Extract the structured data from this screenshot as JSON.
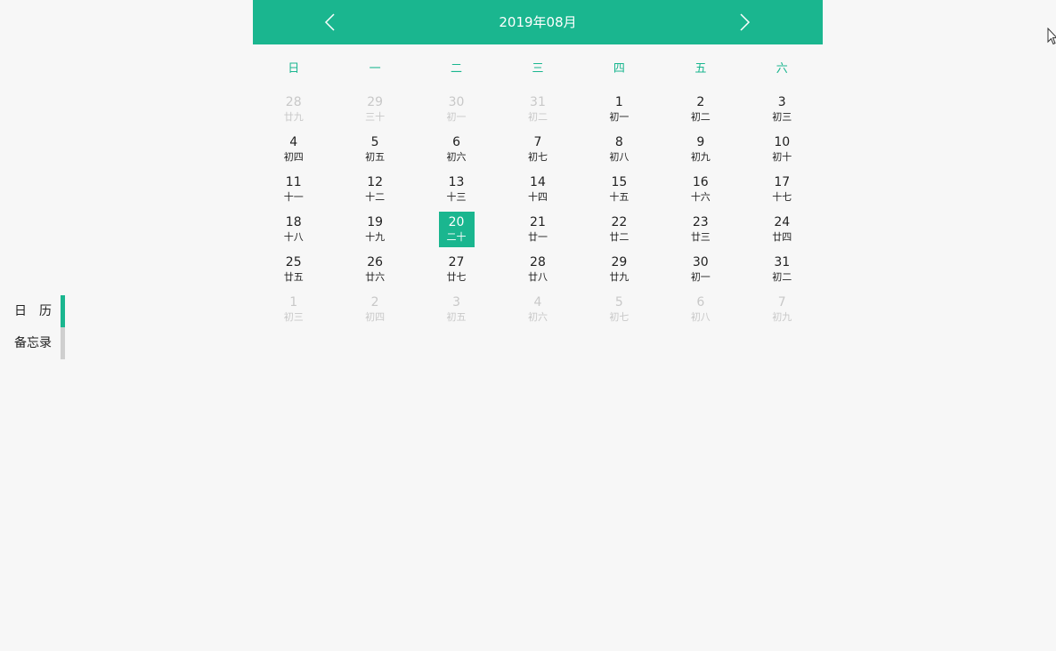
{
  "calendar": {
    "title": "2019年08月",
    "prev_icon": "chevron-left-icon",
    "next_icon": "chevron-right-icon",
    "weekdays": [
      "日",
      "一",
      "二",
      "三",
      "四",
      "五",
      "六"
    ],
    "days": [
      {
        "solar": "28",
        "lunar": "廿九",
        "other": true
      },
      {
        "solar": "29",
        "lunar": "三十",
        "other": true
      },
      {
        "solar": "30",
        "lunar": "初一",
        "other": true
      },
      {
        "solar": "31",
        "lunar": "初二",
        "other": true
      },
      {
        "solar": "1",
        "lunar": "初一"
      },
      {
        "solar": "2",
        "lunar": "初二"
      },
      {
        "solar": "3",
        "lunar": "初三"
      },
      {
        "solar": "4",
        "lunar": "初四"
      },
      {
        "solar": "5",
        "lunar": "初五"
      },
      {
        "solar": "6",
        "lunar": "初六"
      },
      {
        "solar": "7",
        "lunar": "初七"
      },
      {
        "solar": "8",
        "lunar": "初八"
      },
      {
        "solar": "9",
        "lunar": "初九"
      },
      {
        "solar": "10",
        "lunar": "初十"
      },
      {
        "solar": "11",
        "lunar": "十一"
      },
      {
        "solar": "12",
        "lunar": "十二"
      },
      {
        "solar": "13",
        "lunar": "十三"
      },
      {
        "solar": "14",
        "lunar": "十四"
      },
      {
        "solar": "15",
        "lunar": "十五"
      },
      {
        "solar": "16",
        "lunar": "十六"
      },
      {
        "solar": "17",
        "lunar": "十七"
      },
      {
        "solar": "18",
        "lunar": "十八"
      },
      {
        "solar": "19",
        "lunar": "十九"
      },
      {
        "solar": "20",
        "lunar": "二十",
        "selected": true
      },
      {
        "solar": "21",
        "lunar": "廿一"
      },
      {
        "solar": "22",
        "lunar": "廿二"
      },
      {
        "solar": "23",
        "lunar": "廿三"
      },
      {
        "solar": "24",
        "lunar": "廿四"
      },
      {
        "solar": "25",
        "lunar": "廿五"
      },
      {
        "solar": "26",
        "lunar": "廿六"
      },
      {
        "solar": "27",
        "lunar": "廿七"
      },
      {
        "solar": "28",
        "lunar": "廿八"
      },
      {
        "solar": "29",
        "lunar": "廿九"
      },
      {
        "solar": "30",
        "lunar": "初一"
      },
      {
        "solar": "31",
        "lunar": "初二"
      },
      {
        "solar": "1",
        "lunar": "初三",
        "other": true
      },
      {
        "solar": "2",
        "lunar": "初四",
        "other": true
      },
      {
        "solar": "3",
        "lunar": "初五",
        "other": true
      },
      {
        "solar": "4",
        "lunar": "初六",
        "other": true
      },
      {
        "solar": "5",
        "lunar": "初七",
        "other": true
      },
      {
        "solar": "6",
        "lunar": "初八",
        "other": true
      },
      {
        "solar": "7",
        "lunar": "初九",
        "other": true
      }
    ]
  },
  "side_menu": {
    "items": [
      {
        "label": "日　历",
        "active": true
      },
      {
        "label": "备忘录",
        "active": false
      }
    ]
  },
  "colors": {
    "accent": "#1ab68f",
    "background": "#f7f7f7",
    "muted_text": "#c8c8c8",
    "inactive_bar": "#cfcfcf"
  }
}
